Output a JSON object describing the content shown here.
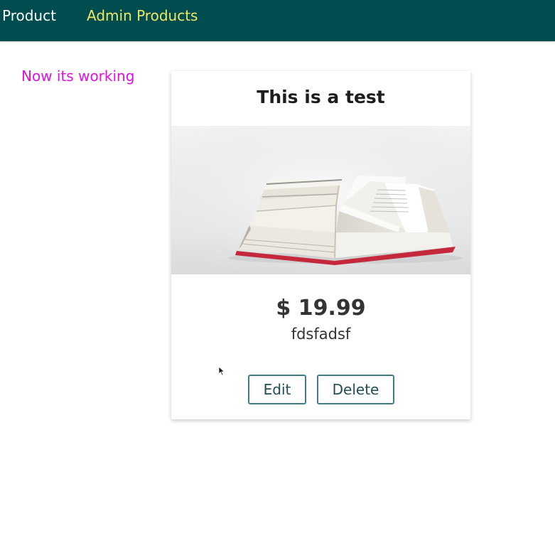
{
  "nav": {
    "product_label": "Product",
    "admin_products_label": "Admin Products"
  },
  "status_message": "Now its working",
  "product_card": {
    "title": "This is a test",
    "image_icon": "open-book-image",
    "price": "$ 19.99",
    "description": "fdsfadsf",
    "edit_label": "Edit",
    "delete_label": "Delete"
  },
  "colors": {
    "header_bg": "#004d4f",
    "nav_active": "#f0e668",
    "status_text": "#e011e0",
    "button_border": "#3f7f82"
  }
}
